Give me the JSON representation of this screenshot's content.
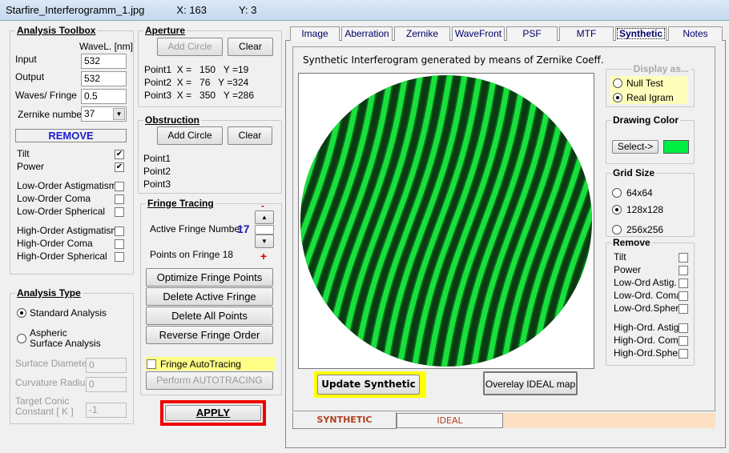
{
  "titlebar": {
    "filename": "Starfire_Interferogramm_1.jpg",
    "x": "X: 163",
    "y": "Y: 3"
  },
  "toolbox": {
    "title": "Analysis Toolbox",
    "wavel_header": "WaveL. [nm]",
    "input_label": "Input",
    "input_value": "532",
    "output_label": "Output",
    "output_value": "532",
    "waves_label": "Waves/ Fringe",
    "waves_value": "0.5",
    "zernike_label": "Zernike number",
    "zernike_value": "37",
    "remove_label": "REMOVE",
    "items": [
      {
        "label": "Tilt",
        "checked": true
      },
      {
        "label": "Power",
        "checked": true
      },
      {
        "label": "Low-Order  Astigmatism",
        "checked": false
      },
      {
        "label": "Low-Order  Coma",
        "checked": false
      },
      {
        "label": "Low-Order  Spherical",
        "checked": false
      },
      {
        "label": "High-Order  Astigmatism",
        "checked": false
      },
      {
        "label": "High-Order  Coma",
        "checked": false
      },
      {
        "label": "High-Order  Spherical",
        "checked": false
      }
    ]
  },
  "analysis_type": {
    "title": "Analysis Type",
    "standard": "Standard Analysis",
    "aspheric": "Aspheric  Surface Analysis",
    "surface_diameter_label": "Surface Diameter",
    "surface_diameter_value": "0",
    "curvature_radius_label": "Curvature Radius",
    "curvature_radius_value": "0",
    "conic_label": "Target Conic Constant [ K ]",
    "conic_value": "-1"
  },
  "aperture": {
    "title": "Aperture",
    "add_circle": "Add Circle",
    "clear": "Clear",
    "points": [
      "Point1  X =   150   Y =19",
      "Point2  X =   76   Y =324",
      "Point3  X =   350   Y =286"
    ]
  },
  "obstruction": {
    "title": "Obstruction",
    "add_circle": "Add Circle",
    "clear": "Clear",
    "points": [
      "Point1",
      "Point2",
      "Point3"
    ]
  },
  "fringe": {
    "title": "Fringe Tracing",
    "minus": "-",
    "plus": "+",
    "active_label": "Active Fringe Number",
    "active_value": "17",
    "points_label": "Points on  Fringe 18",
    "optimize": "Optimize Fringe Points",
    "delete_active": "Delete Active Fringe",
    "delete_all": "Delete  All  Points",
    "reverse": "Reverse  Fringe Order",
    "autotracing": "Fringe AutoTracing",
    "perform": "Perform  AUTOTRACING"
  },
  "apply": "APPLY",
  "tabs": [
    "Image",
    "Aberration",
    "Zernike",
    "WaveFront",
    "PSF",
    "MTF",
    "Synthetic",
    "Notes"
  ],
  "synthetic": {
    "caption": "Synthetic Interferogram generated by means of Zernike Coeff.",
    "display_as": "Display as...",
    "null_test": "Null Test",
    "real_igram": "Real Igram",
    "drawing_color_title": "Drawing Color",
    "select": "Select->",
    "drawing_color": "#00ee44",
    "grid_title": "Grid Size",
    "grid_options": [
      "64x64",
      "128x128",
      "256x256"
    ],
    "grid_selected": "128x128",
    "remove_title": "Remove",
    "remove_items": [
      "Tilt",
      "Power",
      "Low-Ord Astig.",
      "Low-Ord. Coma",
      "Low-Ord.Spher",
      "High-Ord. Astig",
      "High-Ord. Coma",
      "High-Ord.Spher"
    ],
    "update": "Update Synthetic",
    "overlay": "Overelay IDEAL map",
    "bottom_tabs": [
      "SYNTHETIC",
      "IDEAL"
    ]
  }
}
